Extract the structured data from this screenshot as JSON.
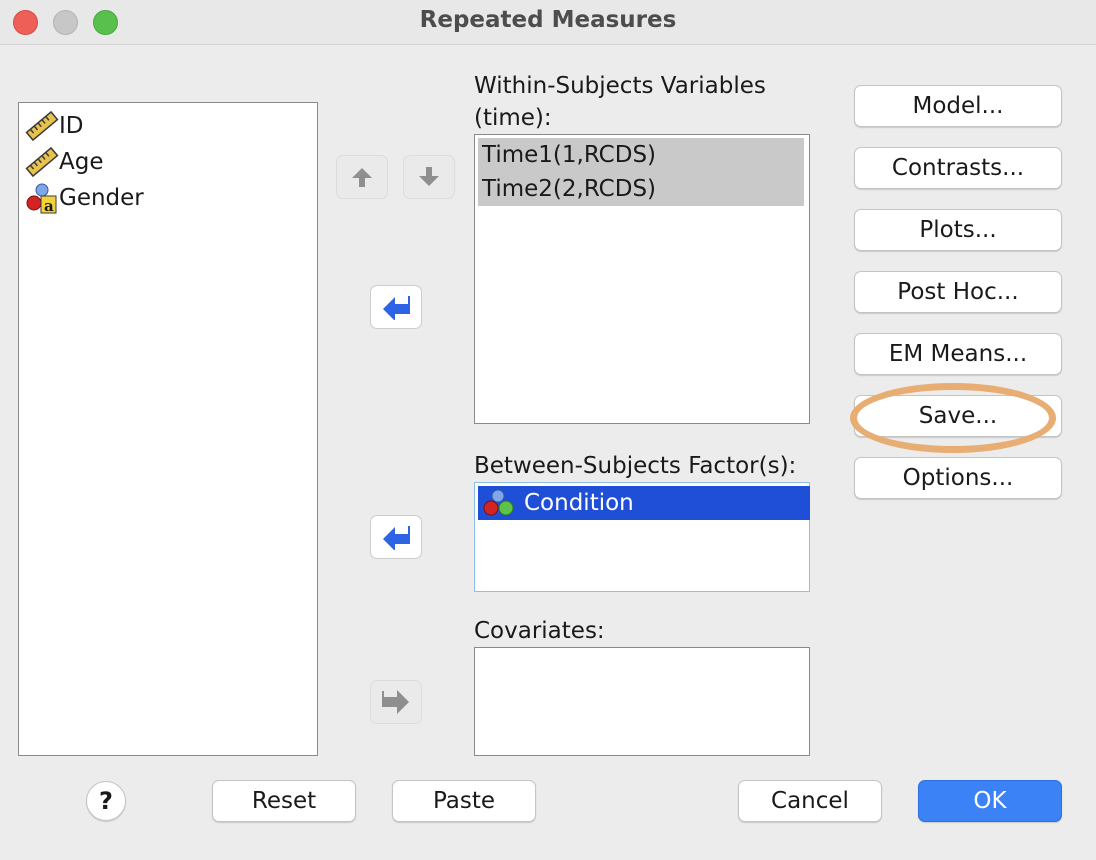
{
  "window": {
    "title": "Repeated Measures"
  },
  "source_variables": [
    {
      "name": "ID",
      "icon": "scale-ruler-icon"
    },
    {
      "name": "Age",
      "icon": "scale-ruler-icon"
    },
    {
      "name": "Gender",
      "icon": "nominal-string-icon"
    }
  ],
  "within": {
    "label_line1": "Within-Subjects Variables",
    "label_line2": "(time):",
    "items": [
      "Time1(1,RCDS)",
      "Time2(2,RCDS)"
    ]
  },
  "between": {
    "label": "Between-Subjects Factor(s):",
    "items": [
      "Condition"
    ]
  },
  "covariates": {
    "label": "Covariates:"
  },
  "side_buttons": {
    "model": "Model...",
    "contrasts": "Contrasts...",
    "plots": "Plots...",
    "post_hoc": "Post Hoc...",
    "em_means": "EM Means...",
    "save": "Save...",
    "options": "Options..."
  },
  "bottom_buttons": {
    "help": "?",
    "reset": "Reset",
    "paste": "Paste",
    "cancel": "Cancel",
    "ok": "OK"
  },
  "colors": {
    "selection_blue": "#1f4fd6",
    "within_selected": "#c9c9c9",
    "highlight_ring": "#e7ad73",
    "ok_blue": "#3b82f6"
  }
}
